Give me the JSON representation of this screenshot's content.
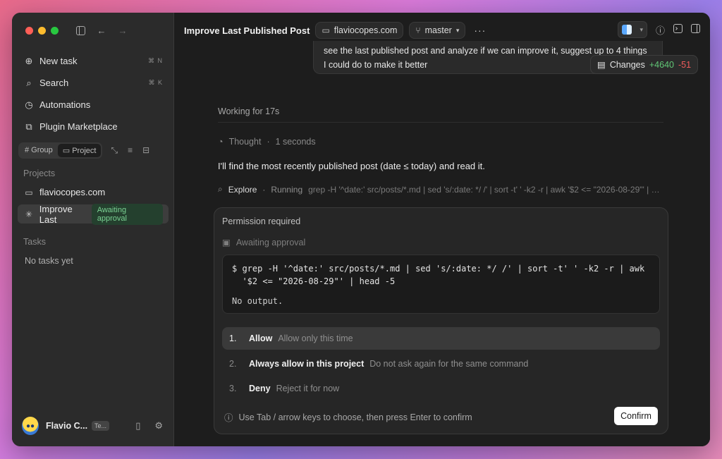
{
  "sidebar": {
    "nav": [
      {
        "label": "New task",
        "shortcut": "⌘ N",
        "icon": "new-task-icon"
      },
      {
        "label": "Search",
        "shortcut": "⌘ K",
        "icon": "search-icon"
      },
      {
        "label": "Automations",
        "shortcut": "",
        "icon": "automations-icon"
      },
      {
        "label": "Plugin Marketplace",
        "shortcut": "",
        "icon": "plugin-icon"
      }
    ],
    "segment": {
      "group": "# Group",
      "project": "Project"
    },
    "projects_heading": "Projects",
    "projects": [
      {
        "label": "flaviocopes.com"
      },
      {
        "label": "Improve Last",
        "badge": "Awaiting approval"
      }
    ],
    "tasks_heading": "Tasks",
    "tasks_empty": "No tasks yet",
    "user": {
      "name": "Flavio C...",
      "tag": "Te..."
    }
  },
  "topbar": {
    "title": "Improve Last Published Post",
    "folder": "flaviocopes.com",
    "branch": "master",
    "more": "···"
  },
  "conversation": {
    "user_message_line1": "see the last published post and analyze if we can improve it, suggest up to 4 things",
    "user_message_line2": "I could do to make it better",
    "changes": {
      "label": "Changes",
      "added": "+4640",
      "removed": "-51"
    },
    "working": "Working for 17s",
    "thought": {
      "label": "Thought",
      "sep": "·",
      "duration": "1 seconds"
    },
    "paragraph": "I'll find the most recently published post (date ≤ today) and read it.",
    "explore": {
      "label": "Explore",
      "sep": "·",
      "status": "Running",
      "command": "grep -H '^date:' src/posts/*.md | sed 's/:date: */ /' | sort -t' ' -k2 -r | awk '$2 <= \"2026-08-29\"' | head -5"
    }
  },
  "permission": {
    "heading": "Permission required",
    "awaiting": "Awaiting approval",
    "code_line1": "$ grep -H '^date:' src/posts/*.md | sed 's/:date: */ /' | sort -t' ' -k2 -r | awk",
    "code_line2": "  '$2 <= \"2026-08-29\"' | head -5",
    "output": "No output.",
    "options": [
      {
        "num": "1.",
        "label": "Allow",
        "desc": "Allow only this time"
      },
      {
        "num": "2.",
        "label": "Always allow in this project",
        "desc": "Do not ask again for the same command"
      },
      {
        "num": "3.",
        "label": "Deny",
        "desc": "Reject it for now"
      }
    ],
    "hint": "Use Tab / arrow keys to choose, then press Enter to confirm",
    "confirm": "Confirm"
  }
}
